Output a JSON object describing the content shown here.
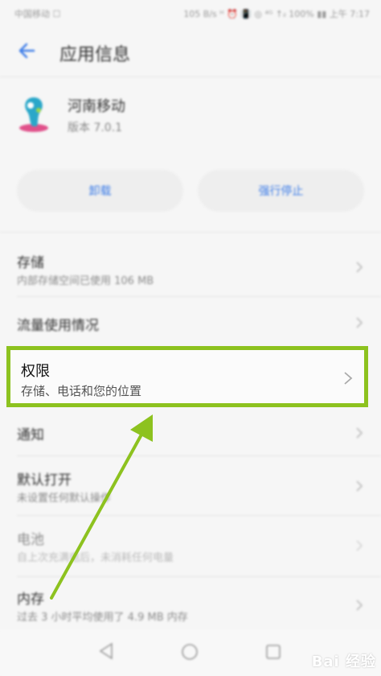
{
  "status_bar": {
    "carrier": "中国移动 ☐",
    "right": "105 B/s ᵸ ⏰ 📳 ◎ ⁴ᴳ ↑ᵢₗ 100% ▮▮ 上午 7:17"
  },
  "header": {
    "title": "应用信息"
  },
  "app": {
    "name": "河南移动",
    "version": "版本 7.0.1"
  },
  "buttons": {
    "uninstall": "卸载",
    "force_stop": "强行停止"
  },
  "rows": {
    "storage": {
      "title": "存储",
      "subtitle": "内部存储空间已使用 106 MB"
    },
    "data_usage": {
      "title": "流量使用情况"
    },
    "permissions": {
      "title": "权限",
      "subtitle": "存储、电话和您的位置"
    },
    "notifications": {
      "title": "通知"
    },
    "open_by_default": {
      "title": "默认打开",
      "subtitle": "未设置任何默认操作"
    },
    "battery": {
      "title": "电池",
      "subtitle": "自上次充满电后，未消耗任何电量"
    },
    "memory": {
      "title": "内存",
      "subtitle": "过去 3 小时平均使用了 4.9 MB 内存"
    }
  },
  "watermark": "Bai 经验",
  "colors": {
    "highlight": "#8dc21f",
    "accent": "#3f7ee8"
  },
  "icons": [
    "back-arrow-icon",
    "app-icon",
    "chevron-right-icon",
    "nav-back-icon",
    "nav-home-icon",
    "nav-recent-icon",
    "annotation-arrow"
  ]
}
